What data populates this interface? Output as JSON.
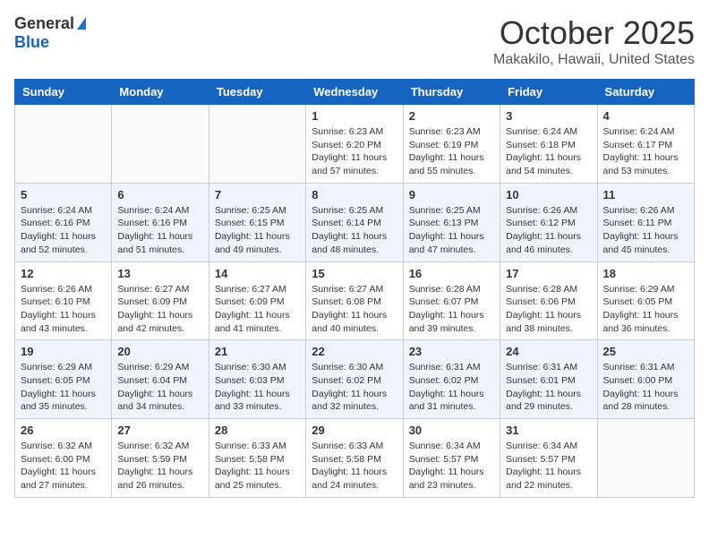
{
  "header": {
    "logo_general": "General",
    "logo_blue": "Blue",
    "month_title": "October 2025",
    "subtitle": "Makakilo, Hawaii, United States"
  },
  "calendar": {
    "days_of_week": [
      "Sunday",
      "Monday",
      "Tuesday",
      "Wednesday",
      "Thursday",
      "Friday",
      "Saturday"
    ],
    "weeks": [
      {
        "alt": false,
        "days": [
          {
            "number": "",
            "info": ""
          },
          {
            "number": "",
            "info": ""
          },
          {
            "number": "",
            "info": ""
          },
          {
            "number": "1",
            "info": "Sunrise: 6:23 AM\nSunset: 6:20 PM\nDaylight: 11 hours\nand 57 minutes."
          },
          {
            "number": "2",
            "info": "Sunrise: 6:23 AM\nSunset: 6:19 PM\nDaylight: 11 hours\nand 55 minutes."
          },
          {
            "number": "3",
            "info": "Sunrise: 6:24 AM\nSunset: 6:18 PM\nDaylight: 11 hours\nand 54 minutes."
          },
          {
            "number": "4",
            "info": "Sunrise: 6:24 AM\nSunset: 6:17 PM\nDaylight: 11 hours\nand 53 minutes."
          }
        ]
      },
      {
        "alt": true,
        "days": [
          {
            "number": "5",
            "info": "Sunrise: 6:24 AM\nSunset: 6:16 PM\nDaylight: 11 hours\nand 52 minutes."
          },
          {
            "number": "6",
            "info": "Sunrise: 6:24 AM\nSunset: 6:16 PM\nDaylight: 11 hours\nand 51 minutes."
          },
          {
            "number": "7",
            "info": "Sunrise: 6:25 AM\nSunset: 6:15 PM\nDaylight: 11 hours\nand 49 minutes."
          },
          {
            "number": "8",
            "info": "Sunrise: 6:25 AM\nSunset: 6:14 PM\nDaylight: 11 hours\nand 48 minutes."
          },
          {
            "number": "9",
            "info": "Sunrise: 6:25 AM\nSunset: 6:13 PM\nDaylight: 11 hours\nand 47 minutes."
          },
          {
            "number": "10",
            "info": "Sunrise: 6:26 AM\nSunset: 6:12 PM\nDaylight: 11 hours\nand 46 minutes."
          },
          {
            "number": "11",
            "info": "Sunrise: 6:26 AM\nSunset: 6:11 PM\nDaylight: 11 hours\nand 45 minutes."
          }
        ]
      },
      {
        "alt": false,
        "days": [
          {
            "number": "12",
            "info": "Sunrise: 6:26 AM\nSunset: 6:10 PM\nDaylight: 11 hours\nand 43 minutes."
          },
          {
            "number": "13",
            "info": "Sunrise: 6:27 AM\nSunset: 6:09 PM\nDaylight: 11 hours\nand 42 minutes."
          },
          {
            "number": "14",
            "info": "Sunrise: 6:27 AM\nSunset: 6:09 PM\nDaylight: 11 hours\nand 41 minutes."
          },
          {
            "number": "15",
            "info": "Sunrise: 6:27 AM\nSunset: 6:08 PM\nDaylight: 11 hours\nand 40 minutes."
          },
          {
            "number": "16",
            "info": "Sunrise: 6:28 AM\nSunset: 6:07 PM\nDaylight: 11 hours\nand 39 minutes."
          },
          {
            "number": "17",
            "info": "Sunrise: 6:28 AM\nSunset: 6:06 PM\nDaylight: 11 hours\nand 38 minutes."
          },
          {
            "number": "18",
            "info": "Sunrise: 6:29 AM\nSunset: 6:05 PM\nDaylight: 11 hours\nand 36 minutes."
          }
        ]
      },
      {
        "alt": true,
        "days": [
          {
            "number": "19",
            "info": "Sunrise: 6:29 AM\nSunset: 6:05 PM\nDaylight: 11 hours\nand 35 minutes."
          },
          {
            "number": "20",
            "info": "Sunrise: 6:29 AM\nSunset: 6:04 PM\nDaylight: 11 hours\nand 34 minutes."
          },
          {
            "number": "21",
            "info": "Sunrise: 6:30 AM\nSunset: 6:03 PM\nDaylight: 11 hours\nand 33 minutes."
          },
          {
            "number": "22",
            "info": "Sunrise: 6:30 AM\nSunset: 6:02 PM\nDaylight: 11 hours\nand 32 minutes."
          },
          {
            "number": "23",
            "info": "Sunrise: 6:31 AM\nSunset: 6:02 PM\nDaylight: 11 hours\nand 31 minutes."
          },
          {
            "number": "24",
            "info": "Sunrise: 6:31 AM\nSunset: 6:01 PM\nDaylight: 11 hours\nand 29 minutes."
          },
          {
            "number": "25",
            "info": "Sunrise: 6:31 AM\nSunset: 6:00 PM\nDaylight: 11 hours\nand 28 minutes."
          }
        ]
      },
      {
        "alt": false,
        "days": [
          {
            "number": "26",
            "info": "Sunrise: 6:32 AM\nSunset: 6:00 PM\nDaylight: 11 hours\nand 27 minutes."
          },
          {
            "number": "27",
            "info": "Sunrise: 6:32 AM\nSunset: 5:59 PM\nDaylight: 11 hours\nand 26 minutes."
          },
          {
            "number": "28",
            "info": "Sunrise: 6:33 AM\nSunset: 5:58 PM\nDaylight: 11 hours\nand 25 minutes."
          },
          {
            "number": "29",
            "info": "Sunrise: 6:33 AM\nSunset: 5:58 PM\nDaylight: 11 hours\nand 24 minutes."
          },
          {
            "number": "30",
            "info": "Sunrise: 6:34 AM\nSunset: 5:57 PM\nDaylight: 11 hours\nand 23 minutes."
          },
          {
            "number": "31",
            "info": "Sunrise: 6:34 AM\nSunset: 5:57 PM\nDaylight: 11 hours\nand 22 minutes."
          },
          {
            "number": "",
            "info": ""
          }
        ]
      }
    ]
  }
}
